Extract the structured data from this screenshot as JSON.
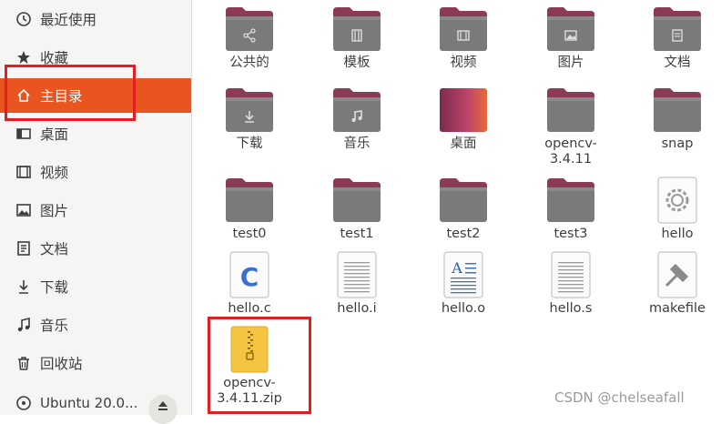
{
  "sidebar": {
    "items": [
      {
        "label": "最近使用",
        "icon": "clock-icon",
        "active": false
      },
      {
        "label": "收藏",
        "icon": "star-icon",
        "active": false
      },
      {
        "label": "主目录",
        "icon": "home-icon",
        "active": true
      },
      {
        "label": "桌面",
        "icon": "desktop-icon",
        "active": false
      },
      {
        "label": "视频",
        "icon": "video-icon",
        "active": false
      },
      {
        "label": "图片",
        "icon": "picture-icon",
        "active": false
      },
      {
        "label": "文档",
        "icon": "document-icon",
        "active": false
      },
      {
        "label": "下载",
        "icon": "download-icon",
        "active": false
      },
      {
        "label": "音乐",
        "icon": "music-icon",
        "active": false
      },
      {
        "label": "回收站",
        "icon": "trash-icon",
        "active": false
      }
    ],
    "device": {
      "label": "Ubuntu 20.0...",
      "icon": "disc-icon",
      "eject_icon": "eject-icon"
    }
  },
  "files": [
    {
      "name": "公共的",
      "type": "folder",
      "emblem": "share"
    },
    {
      "name": "模板",
      "type": "folder",
      "emblem": "template"
    },
    {
      "name": "视频",
      "type": "folder",
      "emblem": "video"
    },
    {
      "name": "图片",
      "type": "folder",
      "emblem": "picture"
    },
    {
      "name": "文档",
      "type": "folder",
      "emblem": "document"
    },
    {
      "name": "下载",
      "type": "folder",
      "emblem": "download"
    },
    {
      "name": "音乐",
      "type": "folder",
      "emblem": "music"
    },
    {
      "name": "桌面",
      "type": "desktop-folder",
      "emblem": ""
    },
    {
      "name": "opencv-\n3.4.11",
      "type": "folder",
      "emblem": ""
    },
    {
      "name": "snap",
      "type": "folder",
      "emblem": ""
    },
    {
      "name": "test0",
      "type": "folder",
      "emblem": ""
    },
    {
      "name": "test1",
      "type": "folder",
      "emblem": ""
    },
    {
      "name": "test2",
      "type": "folder",
      "emblem": ""
    },
    {
      "name": "test3",
      "type": "folder",
      "emblem": ""
    },
    {
      "name": "hello",
      "type": "executable",
      "emblem": "gear"
    },
    {
      "name": "hello.c",
      "type": "c-source",
      "emblem": "C"
    },
    {
      "name": "hello.i",
      "type": "text",
      "emblem": ""
    },
    {
      "name": "hello.o",
      "type": "object",
      "emblem": "A"
    },
    {
      "name": "hello.s",
      "type": "text",
      "emblem": ""
    },
    {
      "name": "makefile",
      "type": "makefile",
      "emblem": "hammer"
    },
    {
      "name": "opencv-\n3.4.11.zip",
      "type": "zip",
      "emblem": ""
    }
  ],
  "colors": {
    "accent": "#e9541f",
    "folder_body": "#7a7a7a",
    "folder_tab": "#8c3b55",
    "annotation": "#e02020"
  },
  "watermark": "CSDN @chelseafall"
}
